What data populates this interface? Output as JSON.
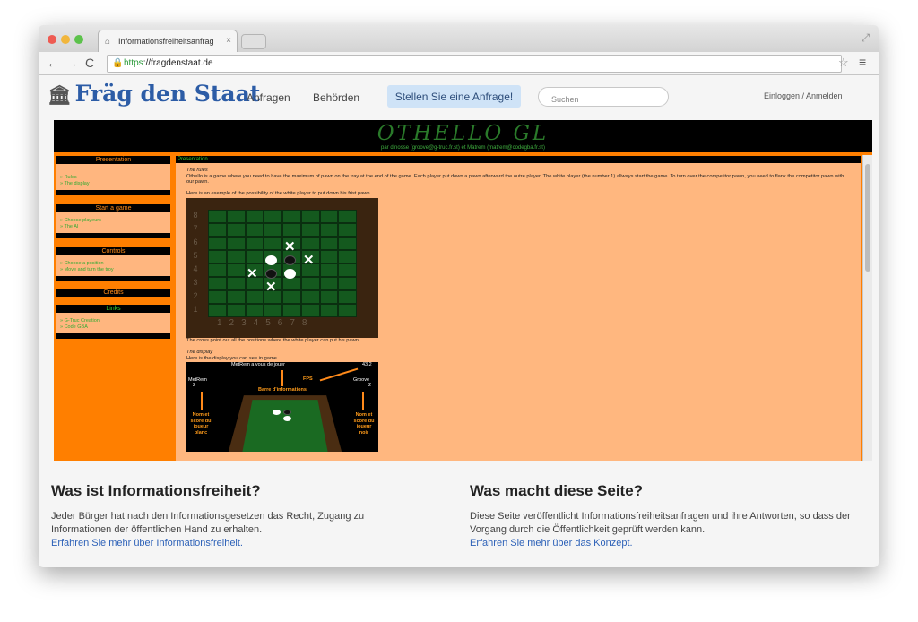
{
  "browser": {
    "tab_title": "Informationsfreiheitsanfrag",
    "url_scheme": "https",
    "url_host": "://fragdenstaat.de"
  },
  "site": {
    "logo": "Fräg den Staat",
    "nav": [
      "Anfragen",
      "Behörden"
    ],
    "cta": "Stellen Sie eine Anfrage!",
    "search_placeholder": "Suchen",
    "login": "Einloggen / Anmelden"
  },
  "embed": {
    "title": "OTHELLO GL",
    "subtitle": "par dinosse (groove@g-truc.fr.st) et Matrem (matrem@codegba.fr.st)",
    "sections": [
      {
        "title": "Presentation",
        "links": [
          "» Rules",
          "» The display"
        ]
      },
      {
        "title": "Start a game",
        "links": [
          "» Choose playeurs",
          "» The AI"
        ]
      },
      {
        "title": "Controls",
        "links": [
          "» Choose a position",
          "» Move and turn the troy"
        ]
      },
      {
        "title": "Credits",
        "links": []
      },
      {
        "title": "Links",
        "links": [
          "» G-Truc Creation",
          "» Code GBA"
        ]
      }
    ],
    "main_title": "Presentation",
    "rules_heading": "The rules",
    "rules_text": "Othello is a game where you need to have the maximum of pawn on the tray at the end of the game. Each player put down a pawn afterward the outre player. The white player (the number 1) allways start the game. To turn over the competitor pawn, you need to flank the competitor pawn with our pawn.",
    "example_text": "Here is an exemple of the possibility of the white player to put down his frist pawn.",
    "board_rows": [
      "8",
      "7",
      "6",
      "5",
      "4",
      "3",
      "2",
      "1"
    ],
    "board_cols": "12345678",
    "cross_caption": "The cross point out all the positions where the white player can put his pawn.",
    "display_heading": "The display",
    "display_text": "Here is the display you can see in game.",
    "shot": {
      "top": "MetRem a vous de jouer",
      "fps_value": "43.2",
      "fps": "FPS",
      "left_name": "MetRem",
      "left_score": "2",
      "right_name": "Groove",
      "right_score": "2",
      "bar": "Barre d'informations",
      "left_label": "Nom et score du joueur blanc",
      "right_label": "Nom et score du joueur noir"
    }
  },
  "footer": {
    "left_heading": "Was ist Informationsfreiheit?",
    "left_text": "Jeder Bürger hat nach den Informationsgesetzen das Recht, Zugang zu Informationen der öffentlichen Hand zu erhalten.",
    "left_link": "Erfahren Sie mehr über Informationsfreiheit.",
    "right_heading": "Was macht diese Seite?",
    "right_text": "Diese Seite veröffentlicht Informationsfreiheitsanfragen und ihre Antworten, so dass der Vorgang durch die Öffentlichkeit geprüft werden kann.",
    "right_link": "Erfahren Sie mehr über das Konzept."
  },
  "colors": {
    "accent_orange": "#ff7f00",
    "link_blue": "#2e62b8",
    "game_green": "#14591e"
  }
}
